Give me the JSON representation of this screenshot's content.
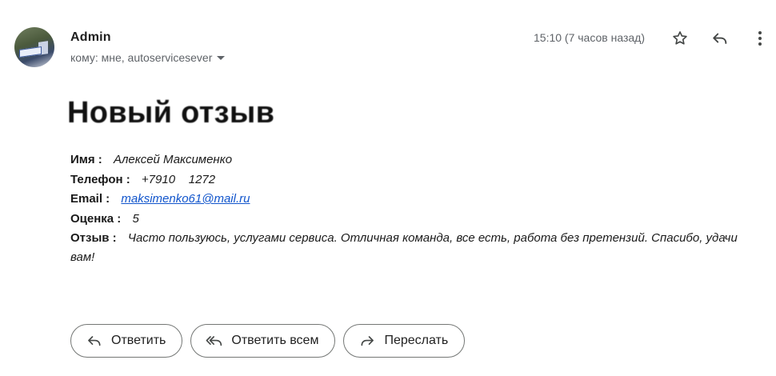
{
  "header": {
    "sender_name": "Admin",
    "recipients": "кому: мне, autoservicesever",
    "timestamp": "15:10 (7 часов назад)",
    "icons": [
      "star-icon",
      "reply-icon",
      "more-vert-icon",
      "chevron-down-icon"
    ]
  },
  "message": {
    "title": "Новый отзыв",
    "fields": {
      "name_label": "Имя :",
      "name_value": "Алексей Максименко",
      "phone_label": "Телефон :",
      "phone_value": "+7910    1272",
      "email_label": "Email :",
      "email_value": "maksimenko61@mail.ru",
      "rating_label": "Оценка :",
      "rating_value": "5",
      "review_label": "Отзыв :",
      "review_value": "Часто пользуюсь, услугами сервиса. Отличная команда, все есть, работа без претензий. Спасибо, удачи вам!"
    }
  },
  "actions": {
    "reply_label": "Ответить",
    "reply_all_label": "Ответить всем",
    "forward_label": "Переслать"
  },
  "colors": {
    "link": "#1155cc",
    "muted_text": "#5f6368",
    "button_border": "#747775"
  }
}
